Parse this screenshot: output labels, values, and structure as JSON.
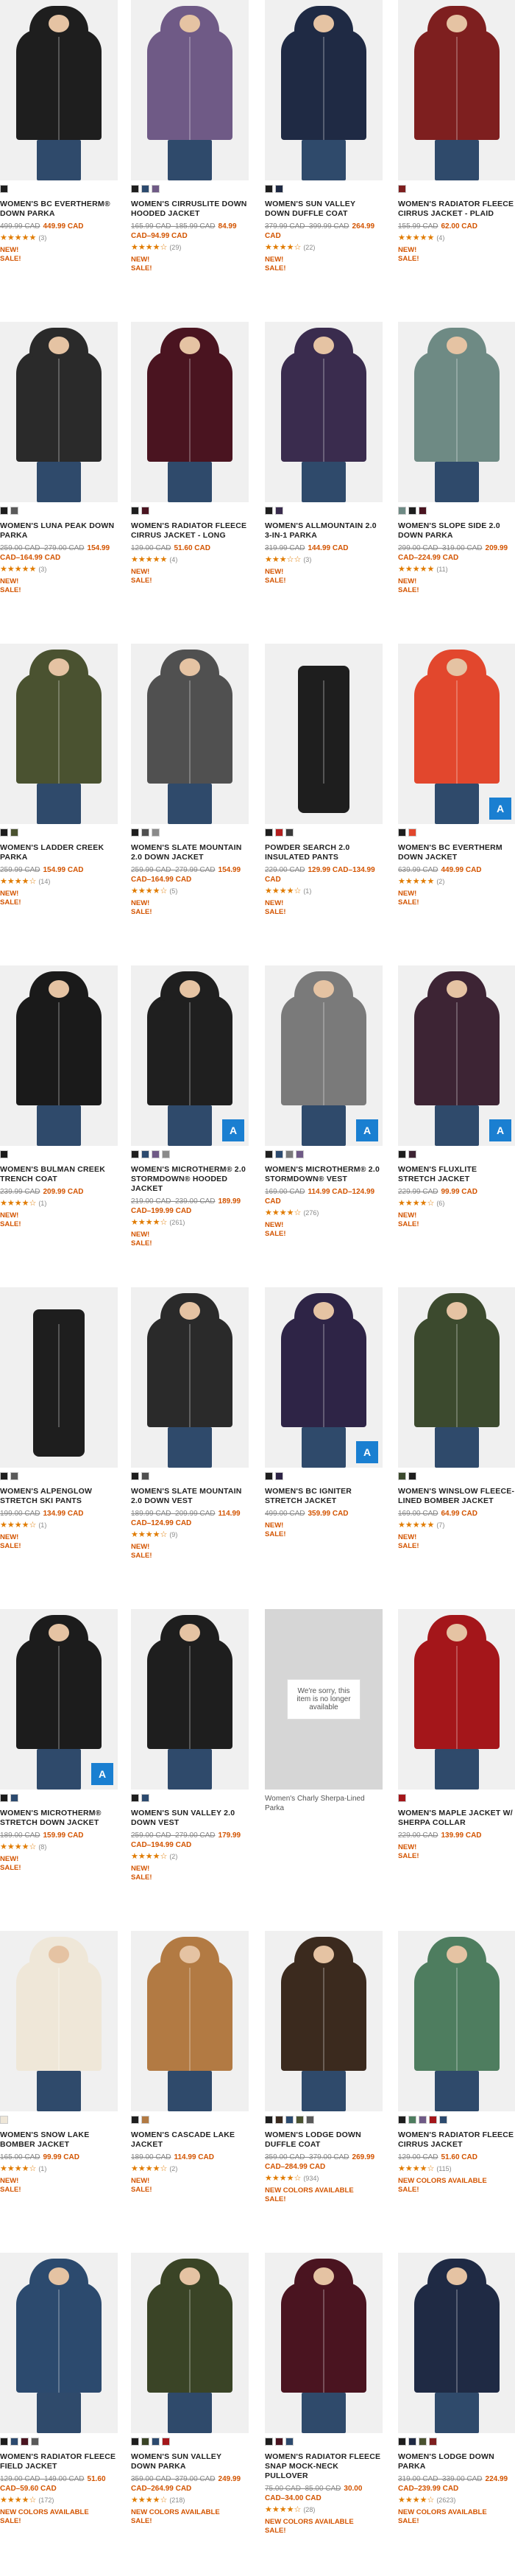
{
  "products": [
    {
      "name": "WOMEN'S BC EVERTHERM® DOWN PARKA",
      "old": "499.99 CAD",
      "price": "449.99 CAD",
      "stars": "★★★★★",
      "count": "(3)",
      "flags": [
        "NEW!",
        "SALE!"
      ],
      "color": "#1e1e1e",
      "swatches": [
        "#1e1e1e"
      ],
      "face": true
    },
    {
      "name": "WOMEN'S CIRRUSLITE DOWN HOODED JACKET",
      "old": "165.99 CAD–185.99 CAD",
      "price": "84.99 CAD–94.99 CAD",
      "stars": "★★★★☆",
      "count": "(29)",
      "flags": [
        "NEW!",
        "SALE!"
      ],
      "color": "#6f5a86",
      "swatches": [
        "#1e1e1e",
        "#2c4a6e",
        "#6f5a86"
      ],
      "face": true
    },
    {
      "name": "WOMEN'S SUN VALLEY DOWN DUFFLE COAT",
      "old": "379.99 CAD–399.99 CAD",
      "price": "264.99 CAD",
      "stars": "★★★★☆",
      "count": "(22)",
      "flags": [
        "NEW!",
        "SALE!"
      ],
      "color": "#1f2a44",
      "swatches": [
        "#1e1e1e",
        "#1f2a44"
      ],
      "face": true
    },
    {
      "name": "WOMEN'S RADIATOR FLEECE CIRRUS JACKET - PLAID",
      "old": "155.99 CAD",
      "price": "62.00 CAD",
      "stars": "★★★★★",
      "count": "(4)",
      "flags": [
        "NEW!",
        "SALE!"
      ],
      "color": "#7e1f1f",
      "swatches": [
        "#7e1f1f"
      ],
      "face": true
    },
    {
      "name": "WOMEN'S LUNA PEAK DOWN PARKA",
      "old": "259.00 CAD–279.00 CAD",
      "price": "154.99 CAD–164.99 CAD",
      "stars": "★★★★★",
      "count": "(3)",
      "flags": [
        "NEW!",
        "SALE!"
      ],
      "color": "#2a2a2a",
      "swatches": [
        "#1e1e1e",
        "#5a5a5a"
      ],
      "face": true
    },
    {
      "name": "WOMEN'S RADIATOR FLEECE CIRRUS JACKET - LONG",
      "old": "129.00 CAD",
      "price": "51.60 CAD",
      "stars": "★★★★★",
      "count": "(4)",
      "flags": [
        "NEW!",
        "SALE!"
      ],
      "color": "#4a1420",
      "swatches": [
        "#1e1e1e",
        "#4a1420"
      ],
      "face": true
    },
    {
      "name": "WOMEN'S ALLMOUNTAIN 2.0 3-IN-1 PARKA",
      "old": "319.99 CAD",
      "price": "144.99 CAD",
      "stars": "★★★☆☆",
      "count": "(3)",
      "flags": [
        "NEW!",
        "SALE!"
      ],
      "color": "#3a2c4e",
      "swatches": [
        "#1e1e1e",
        "#3a2c4e"
      ],
      "face": true
    },
    {
      "name": "WOMEN'S SLOPE SIDE 2.0 DOWN PARKA",
      "old": "299.00 CAD–319.00 CAD",
      "price": "209.99 CAD–224.99 CAD",
      "stars": "★★★★★",
      "count": "(11)",
      "flags": [
        "NEW!",
        "SALE!"
      ],
      "color": "#6e8a84",
      "swatches": [
        "#6e8a84",
        "#1e1e1e",
        "#4a1420"
      ],
      "face": true
    },
    {
      "name": "WOMEN'S LADDER CREEK PARKA",
      "old": "259.99 CAD",
      "price": "154.99 CAD",
      "stars": "★★★★☆",
      "count": "(14)",
      "flags": [
        "NEW!",
        "SALE!"
      ],
      "color": "#4a5230",
      "swatches": [
        "#1e1e1e",
        "#4a5230"
      ],
      "face": true
    },
    {
      "name": "WOMEN'S SLATE MOUNTAIN 2.0 DOWN JACKET",
      "old": "259.99 CAD–279.99 CAD",
      "price": "154.99 CAD–164.99 CAD",
      "stars": "★★★★☆",
      "count": "(5)",
      "flags": [
        "NEW!",
        "SALE!"
      ],
      "color": "#505050",
      "swatches": [
        "#1e1e1e",
        "#505050",
        "#8a8a8a"
      ],
      "face": true
    },
    {
      "name": "POWDER SEARCH 2.0 INSULATED PANTS",
      "old": "229.00 CAD",
      "price": "129.99 CAD–134.99 CAD",
      "stars": "★★★★☆",
      "count": "(1)",
      "flags": [
        "NEW!",
        "SALE!"
      ],
      "color": "#1e1e1e",
      "swatches": [
        "#1e1e1e",
        "#b31d1d",
        "#3a3a3a"
      ],
      "face": false
    },
    {
      "name": "WOMEN'S BC EVERTHERM DOWN JACKET",
      "old": "639.99 CAD",
      "price": "449.99 CAD",
      "stars": "★★★★★",
      "count": "(2)",
      "flags": [
        "NEW!",
        "SALE!"
      ],
      "color": "#e2472d",
      "swatches": [
        "#1e1e1e",
        "#e2472d"
      ],
      "face": true,
      "badge": true
    },
    {
      "name": "WOMEN'S BULMAN CREEK TRENCH COAT",
      "old": "239.99 CAD",
      "price": "209.99 CAD",
      "stars": "★★★★☆",
      "count": "(1)",
      "flags": [
        "NEW!",
        "SALE!"
      ],
      "color": "#1a1a1a",
      "swatches": [
        "#1a1a1a"
      ],
      "face": true
    },
    {
      "name": "WOMEN'S MICROTHERM® 2.0 STORMDOWN® HOODED JACKET",
      "old": "219.00 CAD–239.00 CAD",
      "price": "189.99 CAD–199.99 CAD",
      "stars": "★★★★☆",
      "count": "(261)",
      "flags": [
        "NEW!",
        "SALE!"
      ],
      "color": "#1f1f1f",
      "swatches": [
        "#1f1f1f",
        "#2c4a6e",
        "#6f5a86",
        "#8a8a8a"
      ],
      "face": true,
      "badge": true
    },
    {
      "name": "WOMEN'S MICROTHERM® 2.0 STORMDOWN® VEST",
      "old": "169.00 CAD",
      "price": "114.99 CAD–124.99 CAD",
      "stars": "★★★★☆",
      "count": "(276)",
      "flags": [
        "NEW!",
        "SALE!"
      ],
      "color": "#7a7a7a",
      "swatches": [
        "#1f1f1f",
        "#2c4a6e",
        "#7a7a7a",
        "#6f5a86"
      ],
      "face": true,
      "badge": true
    },
    {
      "name": "WOMEN'S FLUXLITE STRETCH JACKET",
      "old": "229.99 CAD",
      "price": "99.99 CAD",
      "stars": "★★★★☆",
      "count": "(6)",
      "flags": [
        "NEW!",
        "SALE!"
      ],
      "color": "#3d2434",
      "swatches": [
        "#1e1e1e",
        "#3d2434"
      ],
      "face": true,
      "badge": true
    },
    {
      "name": "WOMEN'S ALPENGLOW STRETCH SKI PANTS",
      "old": "199.00 CAD",
      "price": "134.99 CAD",
      "stars": "★★★★☆",
      "count": "(1)",
      "flags": [
        "NEW!",
        "SALE!"
      ],
      "color": "#1e1e1e",
      "swatches": [
        "#1e1e1e",
        "#5a5a5a"
      ],
      "face": false
    },
    {
      "name": "WOMEN'S SLATE MOUNTAIN 2.0 DOWN VEST",
      "old": "189.99 CAD–209.99 CAD",
      "price": "114.99 CAD–124.99 CAD",
      "stars": "★★★★☆",
      "count": "(9)",
      "flags": [
        "NEW!",
        "SALE!"
      ],
      "color": "#2a2a2a",
      "swatches": [
        "#1e1e1e",
        "#505050"
      ],
      "face": true
    },
    {
      "name": "WOMEN'S BC IGNITER STRETCH JACKET",
      "old": "499.00 CAD",
      "price": "359.99 CAD",
      "stars": "",
      "count": "",
      "flags": [
        "NEW!",
        "SALE!"
      ],
      "color": "#2e2446",
      "swatches": [
        "#1e1e1e",
        "#2e2446"
      ],
      "face": true,
      "badge": true
    },
    {
      "name": "WOMEN'S WINSLOW FLEECE-LINED BOMBER JACKET",
      "old": "169.00 CAD",
      "price": "64.99 CAD",
      "stars": "★★★★★",
      "count": "(7)",
      "flags": [
        "NEW!",
        "SALE!"
      ],
      "color": "#3c4a2e",
      "swatches": [
        "#3c4a2e",
        "#1e1e1e"
      ],
      "face": true
    },
    {
      "name": "WOMEN'S MICROTHERM® STRETCH DOWN JACKET",
      "old": "189.00 CAD",
      "price": "159.99 CAD",
      "stars": "★★★★☆",
      "count": "(8)",
      "flags": [
        "NEW!",
        "SALE!"
      ],
      "color": "#1c1c1c",
      "swatches": [
        "#1c1c1c",
        "#2c4a6e"
      ],
      "face": true,
      "badge": true
    },
    {
      "name": "WOMEN'S SUN VALLEY 2.0 DOWN VEST",
      "old": "259.00 CAD–279.00 CAD",
      "price": "179.99 CAD–194.99 CAD",
      "stars": "★★★★☆",
      "count": "(2)",
      "flags": [
        "NEW!",
        "SALE!"
      ],
      "color": "#1e1e1e",
      "swatches": [
        "#1e1e1e",
        "#2c4a6e"
      ],
      "face": true
    },
    {
      "name": "Women's Charly Sherpa-Lined Parka",
      "unavailable": "We're sorry, this item is no longer available",
      "color": "#d6d6d6",
      "face": false
    },
    {
      "name": "WOMEN'S MAPLE JACKET W/ SHERPA COLLAR",
      "old": "229.00 CAD",
      "price": "139.99 CAD",
      "stars": "",
      "count": "",
      "flags": [
        "NEW!",
        "SALE!"
      ],
      "color": "#a4161a",
      "swatches": [
        "#a4161a"
      ],
      "face": true
    },
    {
      "name": "WOMEN'S SNOW LAKE BOMBER JACKET",
      "old": "165.00 CAD",
      "price": "99.99 CAD",
      "stars": "★★★★☆",
      "count": "(1)",
      "flags": [
        "NEW!",
        "SALE!"
      ],
      "color": "#efe7d8",
      "swatches": [
        "#efe7d8"
      ],
      "face": true
    },
    {
      "name": "WOMEN'S CASCADE LAKE JACKET",
      "old": "189.00 CAD",
      "price": "114.99 CAD",
      "stars": "★★★★☆",
      "count": "(2)",
      "flags": [
        "NEW!",
        "SALE!"
      ],
      "color": "#b27a43",
      "swatches": [
        "#1e1e1e",
        "#b27a43"
      ],
      "face": true
    },
    {
      "name": "WOMEN'S LODGE DOWN DUFFLE COAT",
      "old": "359.00 CAD–379.00 CAD",
      "price": "269.99 CAD–284.99 CAD",
      "stars": "★★★★☆",
      "count": "(934)",
      "flags": [
        "NEW COLORS AVAILABLE",
        "SALE!"
      ],
      "color": "#3b2a1e",
      "swatches": [
        "#1e1e1e",
        "#3b2a1e",
        "#2c4a6e",
        "#4a5230",
        "#5a5a5a"
      ],
      "face": true
    },
    {
      "name": "WOMEN'S RADIATOR FLEECE CIRRUS JACKET",
      "old": "129.00 CAD",
      "price": "51.60 CAD",
      "stars": "★★★★☆",
      "count": "(115)",
      "flags": [
        "NEW COLORS AVAILABLE",
        "SALE!"
      ],
      "color": "#4e7d5f",
      "swatches": [
        "#1e1e1e",
        "#4e7d5f",
        "#6f5a86",
        "#a4161a",
        "#2c4a6e"
      ],
      "face": true
    },
    {
      "name": "WOMEN'S RADIATOR FLEECE FIELD JACKET",
      "old": "129.00 CAD–149.00 CAD",
      "price": "51.60 CAD–59.60 CAD",
      "stars": "★★★★☆",
      "count": "(172)",
      "flags": [
        "NEW COLORS AVAILABLE",
        "SALE!"
      ],
      "color": "#2c4a6e",
      "swatches": [
        "#1e1e1e",
        "#2c4a6e",
        "#4a1420",
        "#5a5a5a"
      ],
      "face": true
    },
    {
      "name": "WOMEN'S SUN VALLEY DOWN PARKA",
      "old": "359.00 CAD–379.00 CAD",
      "price": "249.99 CAD–264.99 CAD",
      "stars": "★★★★☆",
      "count": "(218)",
      "flags": [
        "NEW COLORS AVAILABLE",
        "SALE!"
      ],
      "color": "#3a4426",
      "swatches": [
        "#1e1e1e",
        "#3a4426",
        "#2c4a6e",
        "#a4161a"
      ],
      "face": true
    },
    {
      "name": "WOMEN'S RADIATOR FLEECE SNAP MOCK-NECK PULLOVER",
      "old": "75.00 CAD–85.00 CAD",
      "price": "30.00 CAD–34.00 CAD",
      "stars": "★★★★☆",
      "count": "(28)",
      "flags": [
        "NEW COLORS AVAILABLE",
        "SALE!"
      ],
      "color": "#4a1420",
      "swatches": [
        "#1e1e1e",
        "#4a1420",
        "#2c4a6e"
      ],
      "face": true
    },
    {
      "name": "WOMEN'S LODGE DOWN PARKA",
      "old": "319.00 CAD–339.00 CAD",
      "price": "224.99 CAD–239.99 CAD",
      "stars": "★★★★☆",
      "count": "(2623)",
      "flags": [
        "NEW COLORS AVAILABLE",
        "SALE!"
      ],
      "color": "#1f2a44",
      "swatches": [
        "#1e1e1e",
        "#1f2a44",
        "#4a5230",
        "#7e1f1f"
      ],
      "face": true
    }
  ]
}
